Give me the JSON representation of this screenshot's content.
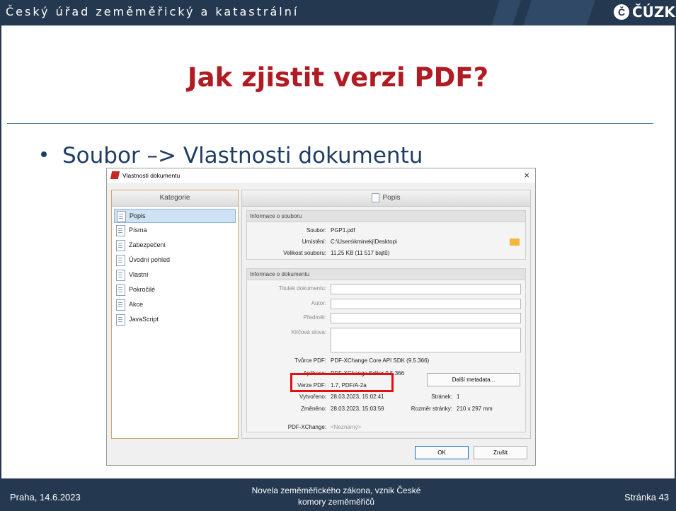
{
  "header": {
    "org_title": "Český úřad zeměměřický a katastrální",
    "logo_text": "ČÚZK"
  },
  "slide": {
    "heading": "Jak zjistit verzi PDF?",
    "bullet": "Soubor –> Vlastnosti dokumentu"
  },
  "footer": {
    "left": "Praha, 14.6.2023",
    "center_line1": "Novela zeměměřického zákona, vznik České",
    "center_line2": "komory zeměměřičů",
    "right": "Stránka 43"
  },
  "dialog": {
    "title": "Vlastnosti dokumentu",
    "close_glyph": "×",
    "categories_header": "Kategorie",
    "categories": [
      {
        "label": "Popis",
        "selected": true
      },
      {
        "label": "Písma"
      },
      {
        "label": "Zabezpečení"
      },
      {
        "label": "Úvodní pohled"
      },
      {
        "label": "Vlastní"
      },
      {
        "label": "Pokročilé"
      },
      {
        "label": "Akce"
      },
      {
        "label": "JavaScript"
      }
    ],
    "main_header": "Popis",
    "file_info": {
      "group_title": "Informace o souboru",
      "file_label": "Soubor:",
      "file_value": "PGP1.pdf",
      "location_label": "Umístění:",
      "location_value": "C:\\Users\\kminekj\\Desktop\\",
      "size_label": "Velikost souboru:",
      "size_value": "11,25 KB (11 517 bajtů)"
    },
    "doc_info": {
      "group_title": "Informace o dokumentu",
      "title_label": "Titulek dokumentu:",
      "author_label": "Autor:",
      "subject_label": "Předmět:",
      "keywords_label": "Klíčová slova:",
      "creator_label": "Tvůrce PDF:",
      "creator_value": "PDF-XChange Core API SDK (9.5.366)",
      "app_label": "Aplikace:",
      "app_value": "PDF-XChange Editor 9.5.366",
      "version_label": "Verze PDF:",
      "version_value": "1.7, PDF/A-2a",
      "created_label": "Vytvořeno:",
      "created_value": "28.03.2023, 15:02:41",
      "modified_label": "Změněno:",
      "modified_value": "28.03.2023, 15:03:59",
      "pages_label": "Stránek:",
      "pages_value": "1",
      "page_size_label": "Rozměr stránky:",
      "page_size_value": "210 x 297 mm",
      "more_metadata_button": "Další metadata...",
      "xchange_label": "PDF-XChange:",
      "xchange_value": "<Neznámý>"
    },
    "ok_button": "OK",
    "cancel_button": "Zrušit"
  },
  "colors": {
    "header_bg": "#24384f",
    "heading_red": "#b01c23",
    "highlight_red": "#e30f12"
  }
}
